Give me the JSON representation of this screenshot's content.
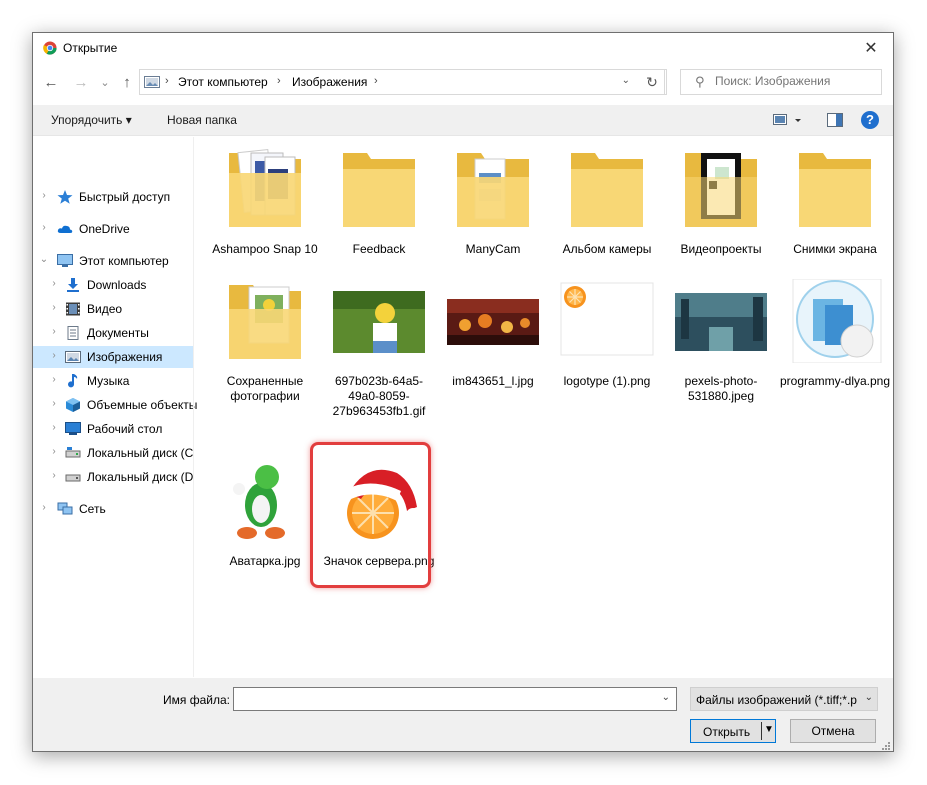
{
  "window": {
    "title": "Открытие",
    "close_glyph": "✕"
  },
  "nav_buttons": {
    "back": "←",
    "forward": "→",
    "recent": "⌄",
    "up": "↑",
    "refresh": "↻"
  },
  "address": {
    "crumbs": [
      "Этот компьютер",
      "Изображения"
    ]
  },
  "search": {
    "placeholder": "Поиск: Изображения"
  },
  "toolbar": {
    "organize_label": "Упорядочить ▾",
    "new_folder_label": "Новая папка",
    "help_glyph": "?"
  },
  "sidebar": {
    "items": [
      {
        "label": "Быстрый доступ",
        "icon": "star-icon"
      },
      {
        "label": "OneDrive",
        "icon": "cloud-icon"
      },
      {
        "label": "Этот компьютер",
        "icon": "computer-icon"
      },
      {
        "label": "Downloads",
        "icon": "download-icon"
      },
      {
        "label": "Видео",
        "icon": "video-icon"
      },
      {
        "label": "Документы",
        "icon": "documents-icon"
      },
      {
        "label": "Изображения",
        "icon": "pictures-icon",
        "selected": true
      },
      {
        "label": "Музыка",
        "icon": "music-icon"
      },
      {
        "label": "Объемные объекты",
        "icon": "3d-objects-icon"
      },
      {
        "label": "Рабочий стол",
        "icon": "desktop-icon"
      },
      {
        "label": "Локальный диск (C",
        "icon": "drive-icon"
      },
      {
        "label": "Локальный диск (D",
        "icon": "drive-icon"
      },
      {
        "label": "Сеть",
        "icon": "network-icon"
      }
    ]
  },
  "files": [
    {
      "name": "Ashampoo Snap 10",
      "type": "folder"
    },
    {
      "name": "Feedback",
      "type": "folder"
    },
    {
      "name": "ManyCam",
      "type": "folder"
    },
    {
      "name": "Альбом камеры",
      "type": "folder"
    },
    {
      "name": "Видеопроекты",
      "type": "folder"
    },
    {
      "name": "Снимки экрана",
      "type": "folder"
    },
    {
      "name": "Сохраненные фотографии",
      "type": "folder"
    },
    {
      "name": "697b023b-64a5-49a0-8059-27b963453fb1.gif",
      "type": "image"
    },
    {
      "name": "im843651_l.jpg",
      "type": "image"
    },
    {
      "name": "logotype (1).png",
      "type": "image"
    },
    {
      "name": "pexels-photo-531880.jpeg",
      "type": "image"
    },
    {
      "name": "programmy-dlya.png",
      "type": "image"
    },
    {
      "name": "Аватарка.jpg",
      "type": "image"
    },
    {
      "name": "Значок сервера.png",
      "type": "image",
      "highlighted": true
    }
  ],
  "footer": {
    "filename_label": "Имя файла:",
    "filename_value": "",
    "filetype_value": "Файлы изображений (*.tiff;*.p",
    "open_label": "Открыть",
    "cancel_label": "Отмена"
  },
  "colors": {
    "selection": "#cce8ff",
    "accent": "#0078d7",
    "highlight_frame": "#e23e3e",
    "folder": "#f8d775"
  }
}
